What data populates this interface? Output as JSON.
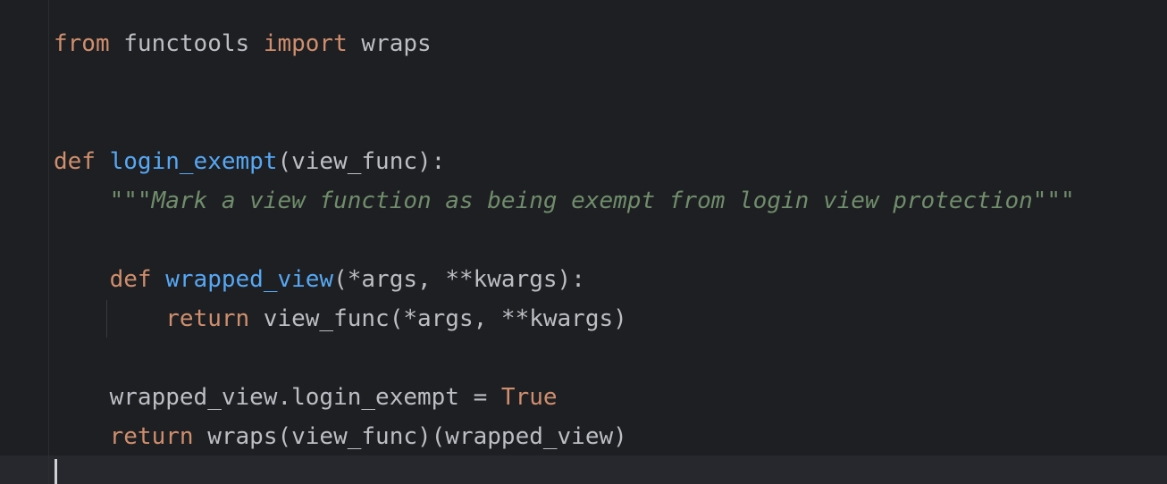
{
  "editor": {
    "lines": {
      "l1": {
        "kw1": "from",
        "t1": " functools ",
        "kw2": "import",
        "t2": " wraps"
      },
      "l4": {
        "kw1": "def",
        "sp": " ",
        "fn": "login_exempt",
        "t1": "(view_func):"
      },
      "l5": {
        "indent": "    ",
        "doc": "\"\"\"Mark a view function as being exempt from login view protection\"\"\""
      },
      "l7": {
        "indent": "    ",
        "kw1": "def",
        "sp": " ",
        "fn": "wrapped_view",
        "t1": "(*args, **kwargs):"
      },
      "l8": {
        "indent": "        ",
        "kw1": "return",
        "t1": " view_func(*args, **kwargs)"
      },
      "l10": {
        "indent": "    ",
        "t1": "wrapped_view.login_exempt = ",
        "kw1": "True"
      },
      "l11": {
        "indent": "    ",
        "kw1": "return",
        "t1": " wraps(view_func)(wrapped_view)"
      }
    }
  },
  "colors": {
    "background": "#1e1f22",
    "keyword": "#cf8e6d",
    "function_name": "#56a8f5",
    "docstring": "#6f8d6b",
    "text": "#bcbec4",
    "current_line": "#26282e"
  }
}
